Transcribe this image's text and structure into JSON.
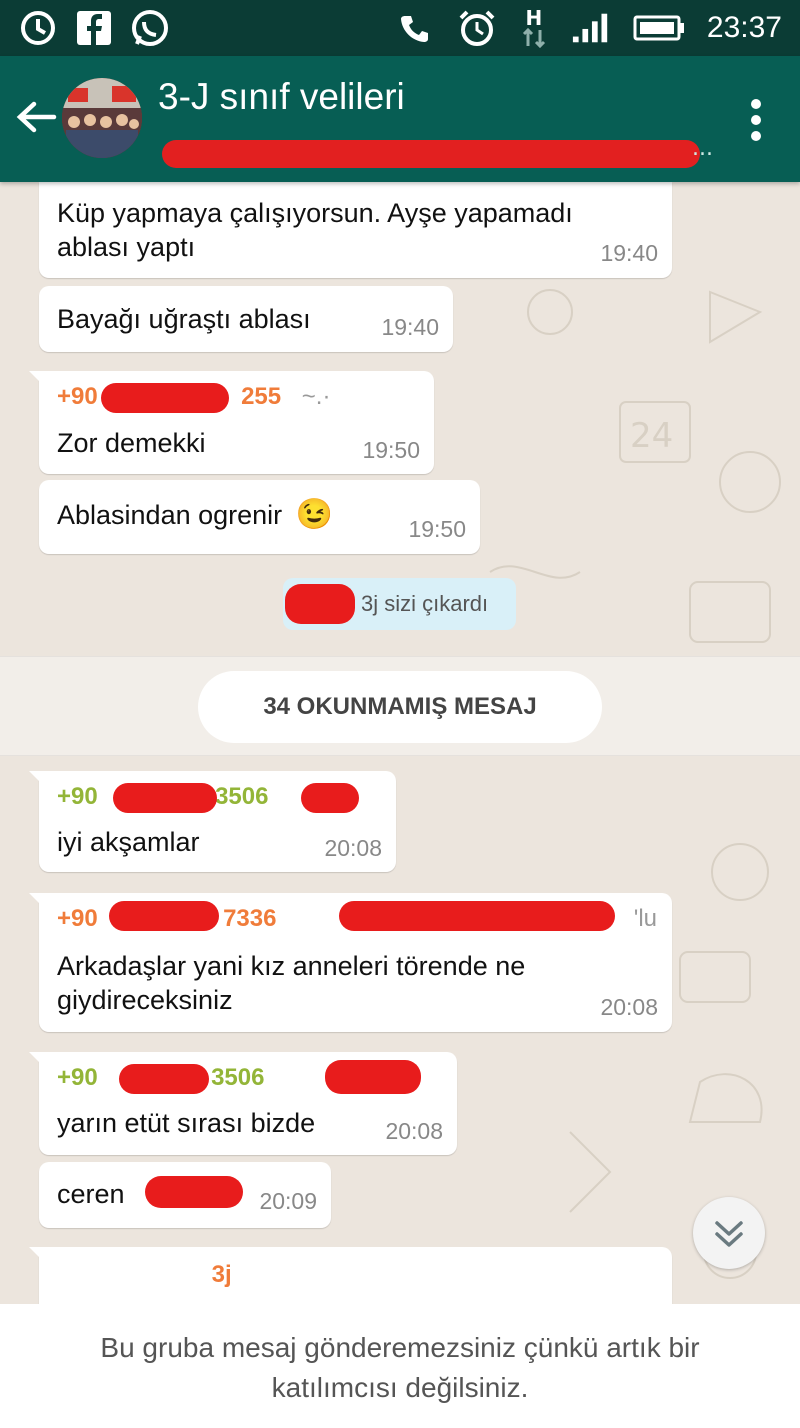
{
  "status_bar": {
    "time": "23:37",
    "network": "H",
    "left_icons": [
      "sync-icon",
      "facebook-icon",
      "whatsapp-icon"
    ],
    "right_icons": [
      "call-icon",
      "alarm-icon",
      "network-h-icon",
      "signal-icon",
      "battery-icon"
    ]
  },
  "header": {
    "title": "3-J sınıf velileri",
    "subtitle": "..."
  },
  "messages": [
    {
      "text_line1": "Küp yapmaya çalışıyorsun. Ayşe yapamadı",
      "text_line2": "ablası yaptı",
      "time": "19:40"
    },
    {
      "text": "Bayağı uğraştı ablası",
      "time": "19:40"
    },
    {
      "sender_prefix": "+90",
      "sender_suffix": "255",
      "sender_extra": "~.·",
      "text": "Zor demekki",
      "time": "19:50"
    },
    {
      "text": "Ablasindan ogrenir",
      "emoji": "😉",
      "time": "19:50"
    }
  ],
  "system_message": "3j sizi çıkardı",
  "unread_label": "34 OKUNMAMIŞ MESAJ",
  "unread_messages": [
    {
      "sender_prefix": "+90",
      "sender_suffix": "3506",
      "text": "iyi akşamlar",
      "time": "20:08"
    },
    {
      "sender_prefix": "+90",
      "sender_suffix": "7336",
      "sender_extra": "'lu",
      "text_line1": "Arkadaşlar yani kız anneleri törende ne",
      "text_line2": "giydireceksiniz",
      "time": "20:08"
    },
    {
      "sender_prefix": "+90",
      "sender_suffix": "3506",
      "text": "yarın etüt sırası bizde",
      "time": "20:08"
    },
    {
      "text": "ceren",
      "time": "20:09"
    },
    {
      "sender_partial": "3j"
    }
  ],
  "bottom_notice": "Bu gruba mesaj gönderemezsiniz çünkü artık bir katılımcısı değilsiniz.",
  "colors": {
    "status_bar": "#0b3c35",
    "app_bar": "#075e54",
    "chat_bg": "#ece5dd",
    "sender_orange": "#f07c3a",
    "sender_green": "#93b538",
    "redaction": "#e81c1c"
  }
}
